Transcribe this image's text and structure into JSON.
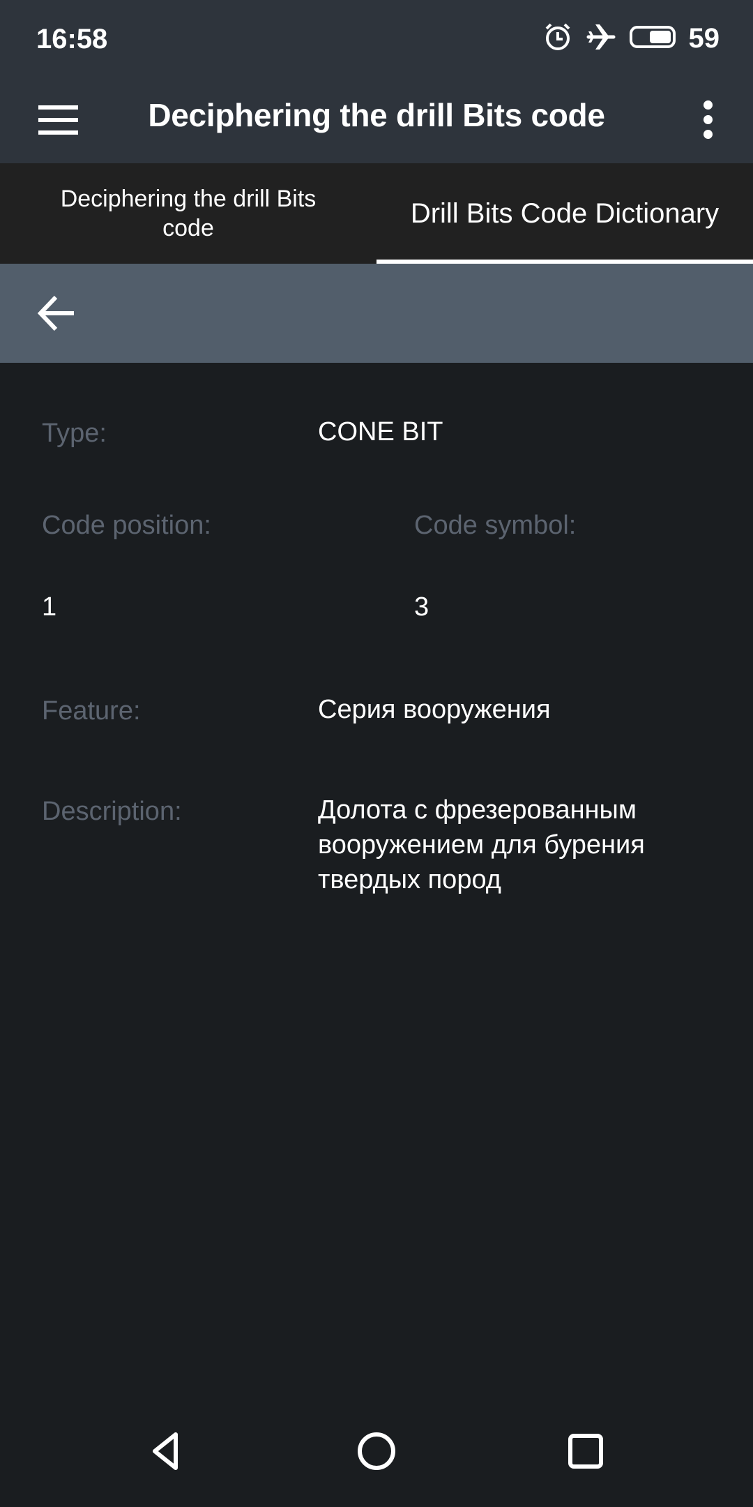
{
  "status_bar": {
    "time": "16:58",
    "icons": [
      "alarm-icon",
      "airplane-mode-icon",
      "battery-icon"
    ],
    "battery_level": "59"
  },
  "app_bar": {
    "title": "Deciphering the drill Bits code",
    "menu_icon": "hamburger-menu-icon",
    "overflow_icon": "more-vert-icon"
  },
  "tabs": [
    {
      "label": "Deciphering the drill Bits code",
      "active": false
    },
    {
      "label": "Drill Bits Code Dictionary",
      "active": true
    }
  ],
  "toolbar": {
    "back_icon": "arrow-back-icon"
  },
  "details": {
    "type_label": "Type:",
    "type_value": "CONE BIT",
    "code_position_label": "Code position:",
    "code_position_value": "1",
    "code_symbol_label": "Code symbol:",
    "code_symbol_value": "3",
    "feature_label": "Feature:",
    "feature_value": "Серия вооружения",
    "description_label": "Description:",
    "description_value": "Долота с фрезерованным вооружением для бурения твердых пород"
  },
  "nav_bar": {
    "buttons": [
      "back-triangle-icon",
      "home-circle-icon",
      "recents-square-icon"
    ]
  },
  "colors": {
    "app_bar_bg": "#2e343c",
    "tabs_bg": "#212121",
    "subbar_bg": "#525e6b",
    "content_bg": "#1a1d20",
    "label_text": "#5c6470",
    "value_text": "#ffffff"
  }
}
